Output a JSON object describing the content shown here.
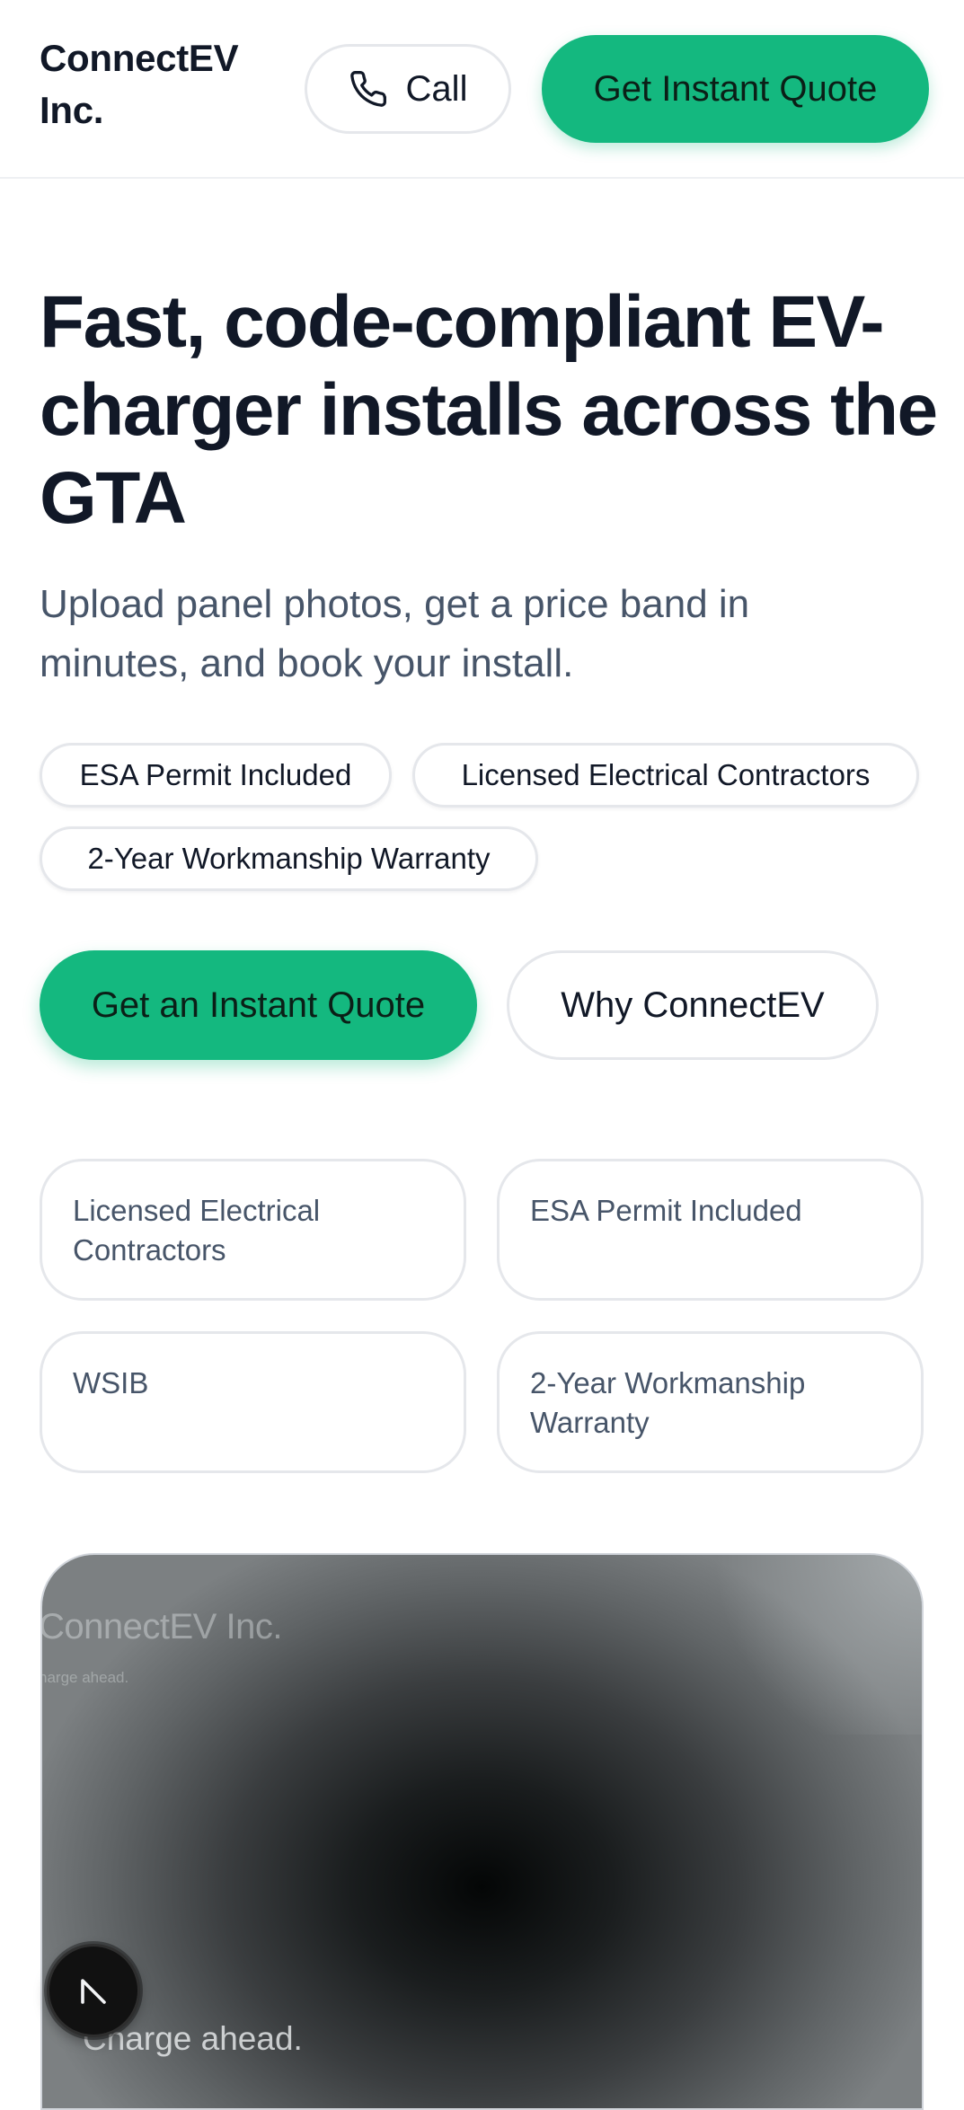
{
  "header": {
    "brand": "ConnectEV Inc.",
    "call_label": "Call",
    "call_icon": "phone-icon",
    "quote_label": "Get Instant Quote"
  },
  "hero": {
    "title": "Fast, code-compliant EV-charger installs across the GTA",
    "subtitle": "Upload panel photos, get a price band in minutes, and book your install.",
    "badges": [
      "ESA Permit Included",
      "Licensed Electrical Contractors",
      "2-Year Workmanship Warranty"
    ],
    "cta_primary": "Get an Instant Quote",
    "cta_secondary": "Why ConnectEV"
  },
  "features": [
    "Licensed Electrical Contractors",
    "ESA Permit Included",
    "WSIB",
    "2-Year Workmanship Warranty"
  ],
  "media": {
    "brand": "ConnectEV Inc.",
    "tagline": "harge ahead.",
    "caption": "Charge ahead."
  },
  "floating_button": {
    "icon": "n-logo-icon"
  },
  "colors": {
    "accent": "#14b87f",
    "text_primary": "#111827",
    "text_muted": "#475569",
    "border": "#e5e7eb"
  }
}
